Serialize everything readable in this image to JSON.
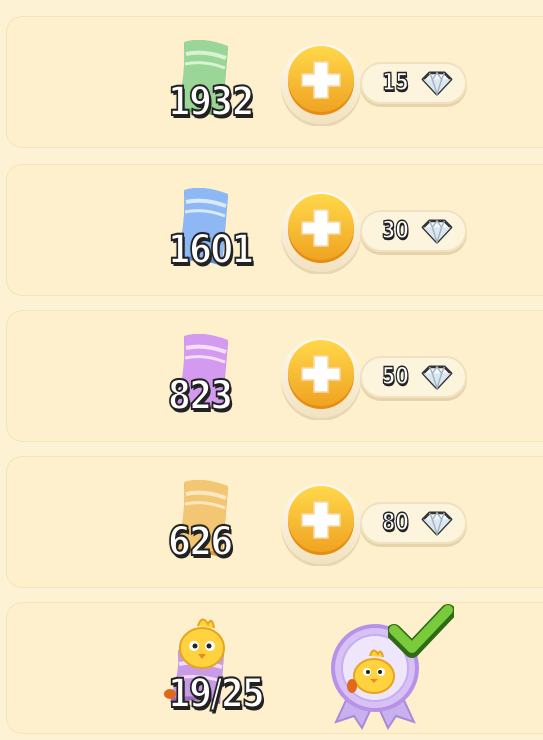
{
  "rows": [
    {
      "count": "1932",
      "cost": "15",
      "ticket_color": "green-ticket"
    },
    {
      "count": "1601",
      "cost": "30",
      "ticket_color": "blue-ticket"
    },
    {
      "count": "823",
      "cost": "50",
      "ticket_color": "purple-ticket"
    },
    {
      "count": "626",
      "cost": "80",
      "ticket_color": "orange-ticket"
    }
  ],
  "reward_row": {
    "progress": "19/25",
    "completed": true
  },
  "colors": {
    "green": "#8fd08c",
    "blue": "#7fb0f0",
    "purple": "#cf8fe8",
    "orange": "#f1c26c",
    "gold": "#f4b327",
    "badge": "#d8c3f3",
    "check": "#6bbe36"
  },
  "icons": [
    "ticket-icon",
    "plus-icon",
    "diamond-icon",
    "chick-badge-icon",
    "checkmark-icon"
  ]
}
